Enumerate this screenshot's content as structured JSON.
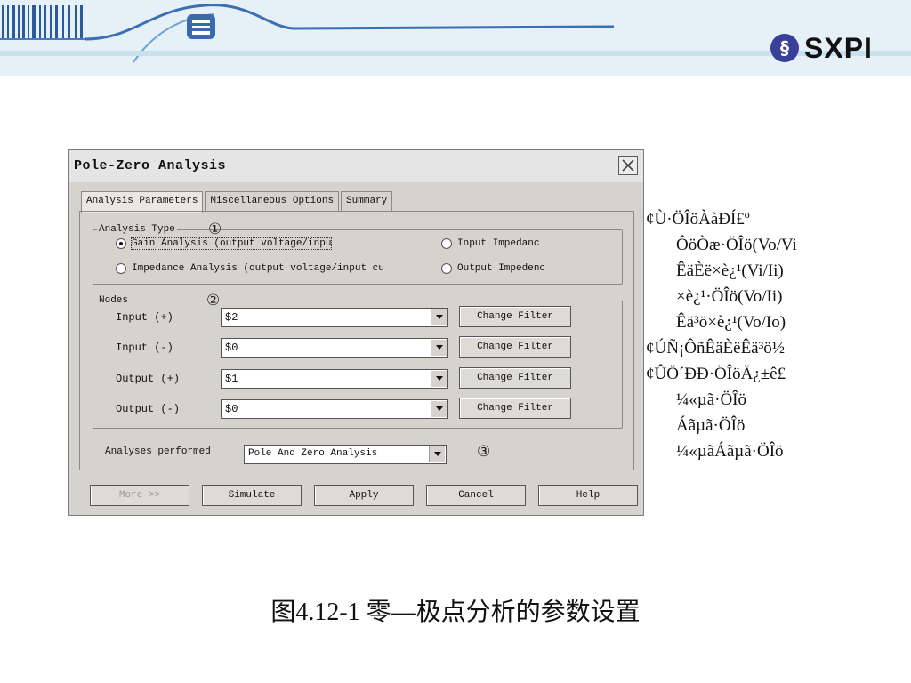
{
  "brand": {
    "name": "SXPI",
    "icon": "sxpi-logo-icon"
  },
  "dialog": {
    "title": "Pole-Zero Analysis",
    "close_icon": "close-icon",
    "tabs": [
      {
        "label": "Analysis Parameters"
      },
      {
        "label": "Miscellaneous Options"
      },
      {
        "label": "Summary"
      }
    ],
    "analysis_type": {
      "legend": "Analysis Type",
      "marker": "①",
      "options": [
        {
          "label": "Gain Analysis (output voltage/inpu",
          "selected": true
        },
        {
          "label": "Input Impedanc",
          "selected": false
        },
        {
          "label": "Impedance Analysis (output voltage/input cu",
          "selected": false
        },
        {
          "label": "Output Impedenc",
          "selected": false
        }
      ]
    },
    "nodes": {
      "legend": "Nodes",
      "marker": "②",
      "rows": [
        {
          "label": "Input (+)",
          "value": "$2",
          "button": "Change Filter"
        },
        {
          "label": "Input (-)",
          "value": "$0",
          "button": "Change Filter"
        },
        {
          "label": "Output (+)",
          "value": "$1",
          "button": "Change Filter"
        },
        {
          "label": "Output (-)",
          "value": "$0",
          "button": "Change Filter"
        }
      ]
    },
    "analyses": {
      "label": "Analyses performed",
      "value": "Pole And Zero Analysis",
      "marker": "③"
    },
    "buttons": {
      "more": "More >>",
      "simulate": "Simulate",
      "apply": "Apply",
      "cancel": "Cancel",
      "help": "Help"
    }
  },
  "side_text": [
    "¢Ù·ÖÎöÀàÐÍ£º",
    "ÔöÒæ·ÖÎö(Vo/Vi",
    "ÊäÈë×è¿¹(Vi/Ii)",
    "×è¿¹·ÖÎö(Vo/Ii)",
    "Êä³ö×è¿¹(Vo/Io)",
    "¢ÚÑ¡ÔñÊäÈëÊä³ö½",
    "¢ÛÖ´ÐÐ·ÖÎöÄ¿±ê£",
    "¼«µã·ÖÎö",
    "Áãµã·ÖÎö",
    "¼«µãÁãµã·ÖÎö"
  ],
  "caption": "图4.12-1  零—极点分析的参数设置"
}
